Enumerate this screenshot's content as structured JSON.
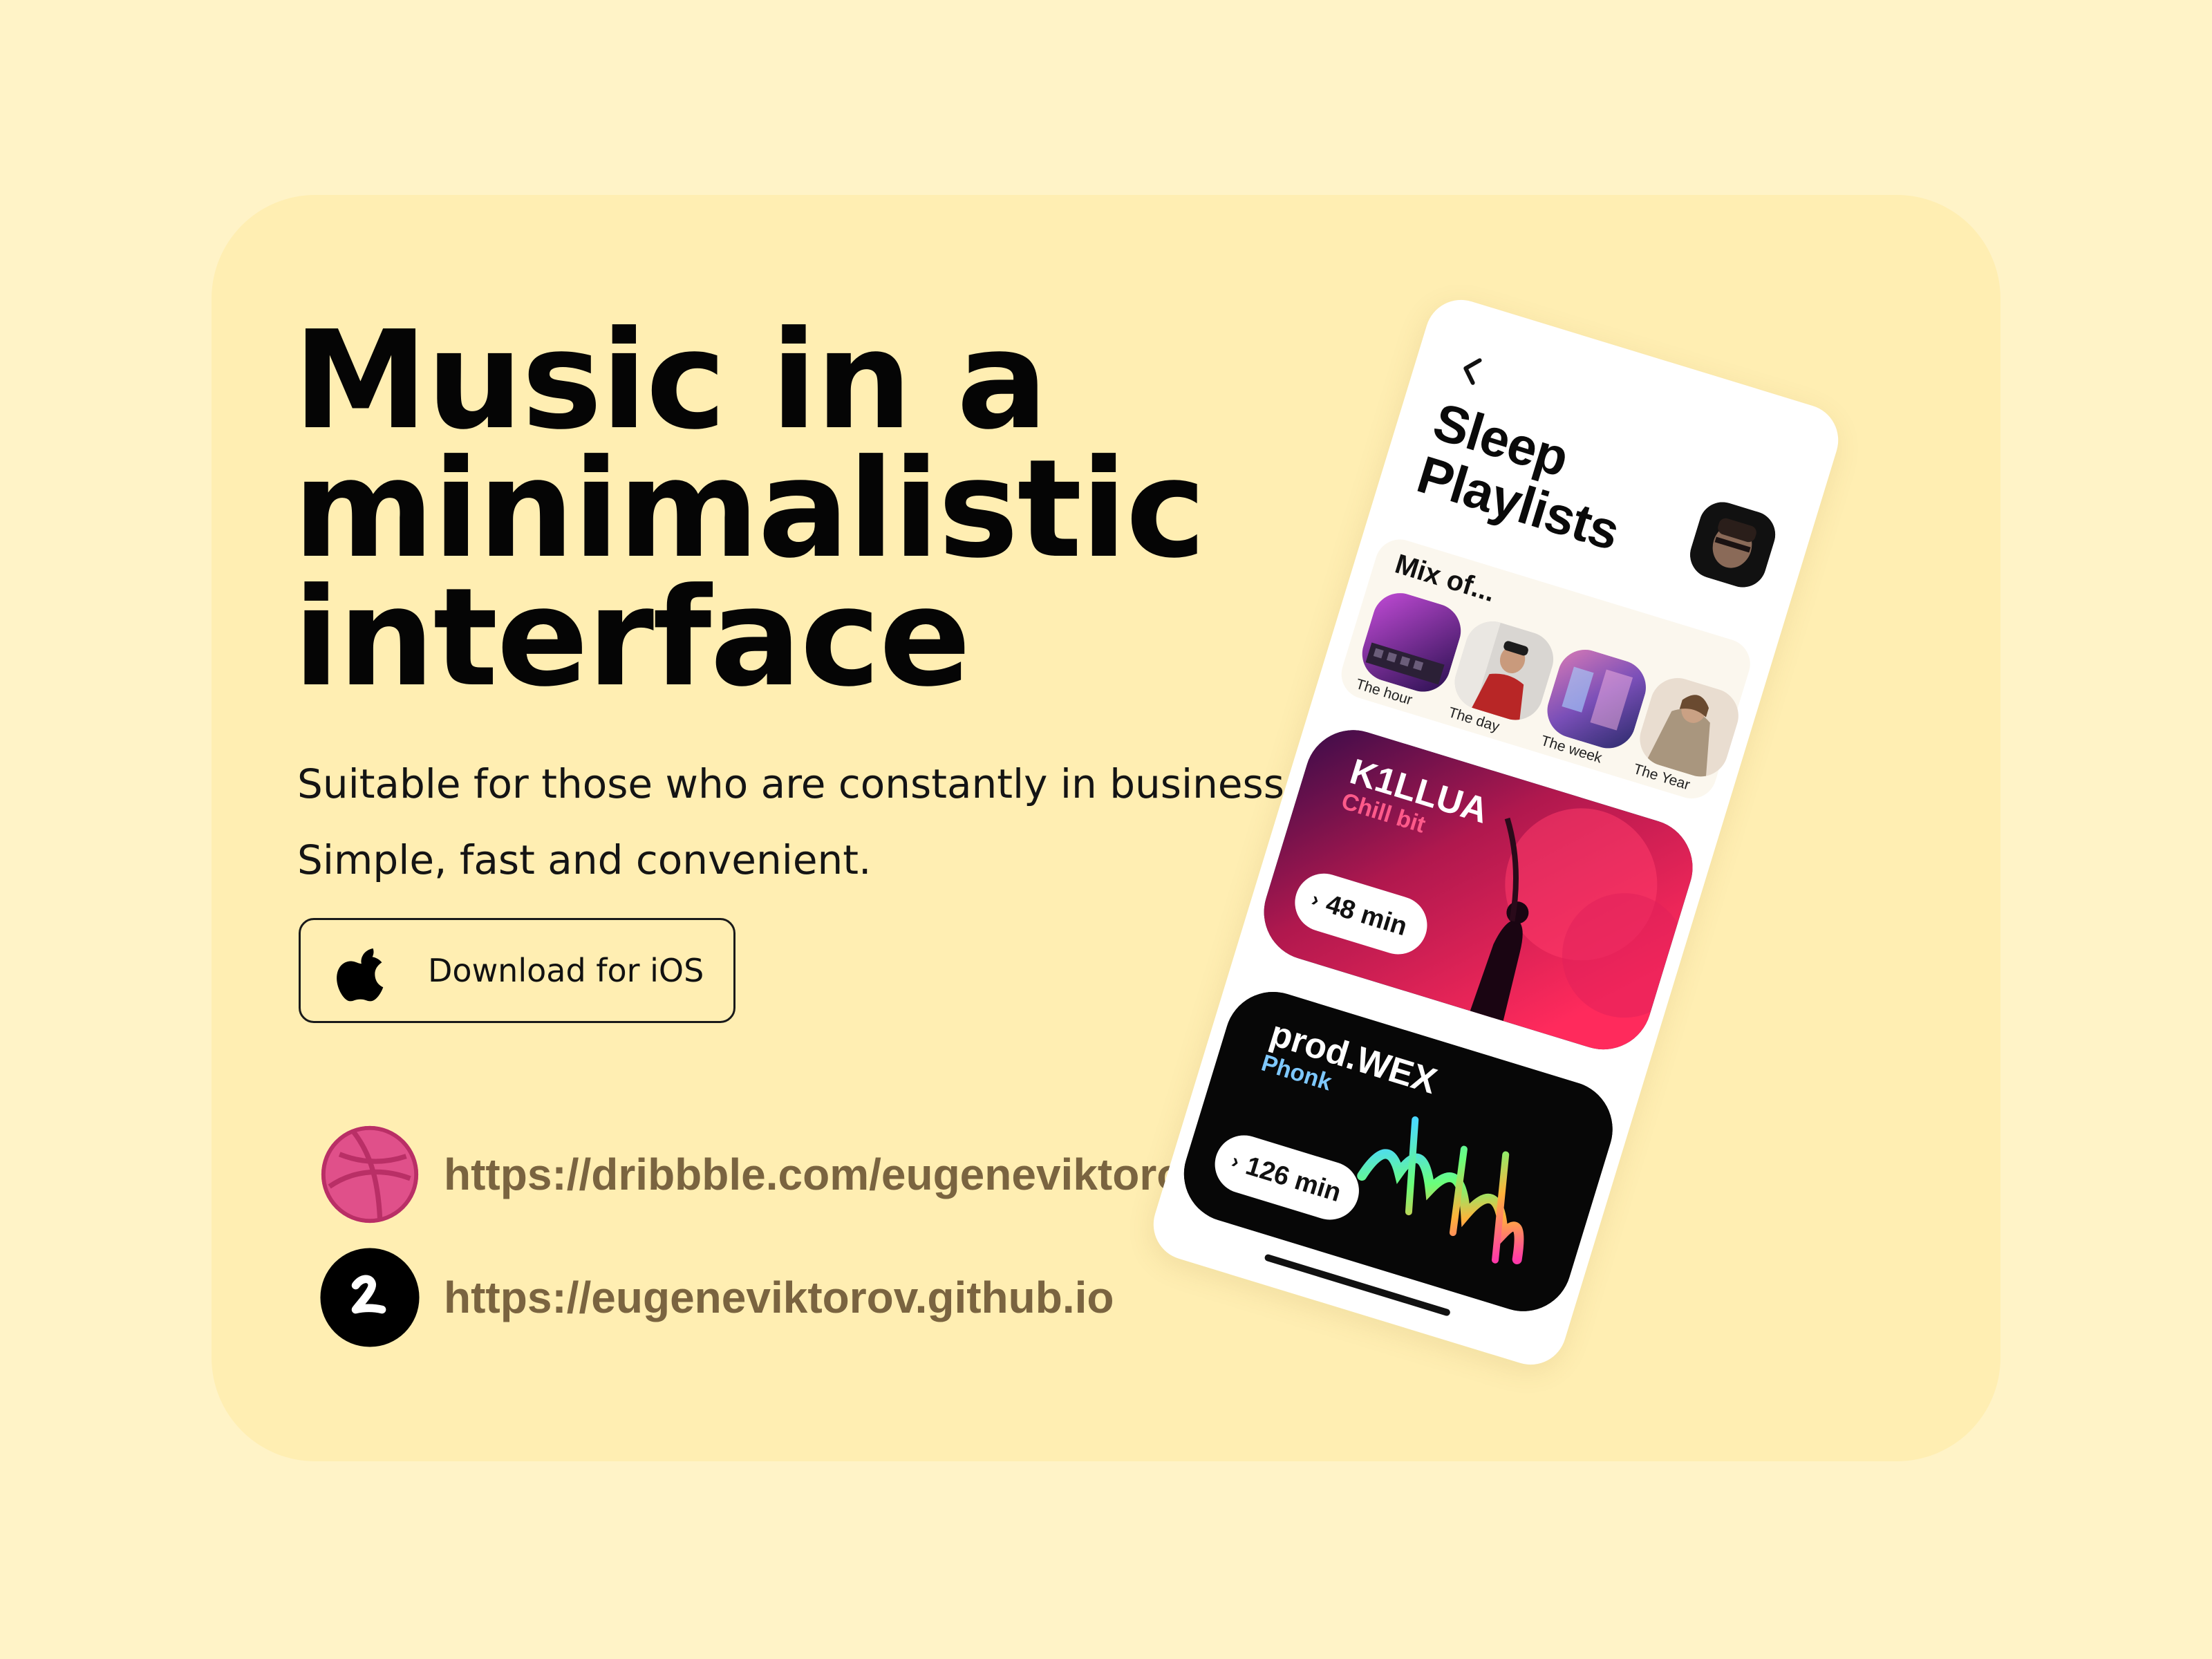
{
  "hero": {
    "title_lines": [
      "Music in a",
      "minimalistic",
      "interface"
    ],
    "subtitle_line1": "Suitable for those who are constantly in business.",
    "subtitle_line2": "Simple, fast and convenient."
  },
  "download_button": {
    "label": "Download for iOS",
    "icon": "apple-icon"
  },
  "links": [
    {
      "text": "https://dribbble.com/eugeneviktorov",
      "icon": "dribbble-icon",
      "color": "#e0508a"
    },
    {
      "text": "https://eugeneviktorov.github.io",
      "icon": "personal-logo-icon",
      "color": "#000000"
    }
  ],
  "phone": {
    "title_line1": "Sleep",
    "title_line2": "Playlists",
    "mix": {
      "title": "Mix of...",
      "items": [
        {
          "label": "The hour"
        },
        {
          "label": "The day"
        },
        {
          "label": "The week"
        },
        {
          "label": "The Year"
        }
      ]
    },
    "playlists": [
      {
        "name": "K1LLUA",
        "genre": "Chill bit",
        "duration": "48 min"
      },
      {
        "name": "prod.WEX",
        "genre": "Phonk",
        "duration": "126 min"
      }
    ]
  },
  "colors": {
    "background": "#fff3c7",
    "card": "#ffeeb2",
    "link_text": "#7a6440"
  }
}
